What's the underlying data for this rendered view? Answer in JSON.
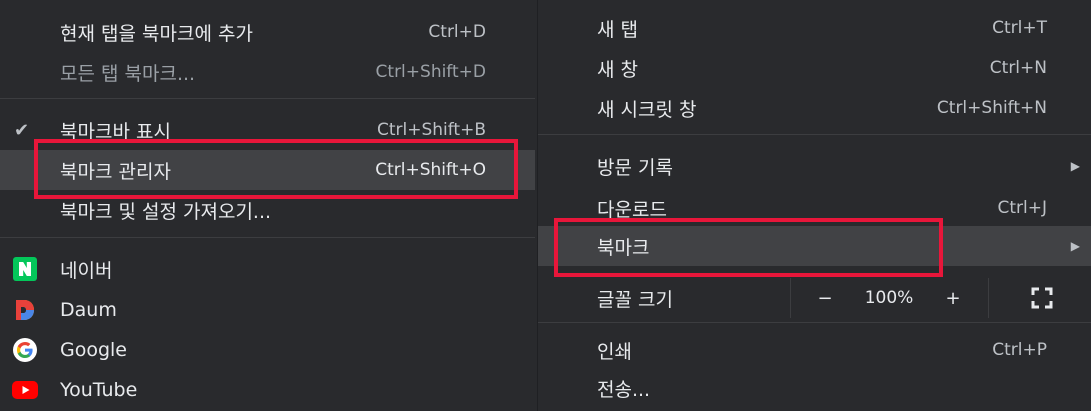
{
  "left_menu": {
    "items": [
      {
        "label": "현재 탭을 북마크에 추가",
        "shortcut": "Ctrl+D"
      },
      {
        "label": "모든 탭 북마크...",
        "shortcut": "Ctrl+Shift+D"
      },
      {
        "label": "북마크바 표시",
        "shortcut": "Ctrl+Shift+B",
        "checked": true
      },
      {
        "label": "북마크 관리자",
        "shortcut": "Ctrl+Shift+O"
      },
      {
        "label": "북마크 및 설정 가져오기..."
      }
    ],
    "bookmarks": [
      {
        "label": "네이버",
        "icon": "naver-icon"
      },
      {
        "label": "Daum",
        "icon": "daum-icon"
      },
      {
        "label": "Google",
        "icon": "google-icon"
      },
      {
        "label": "YouTube",
        "icon": "youtube-icon"
      }
    ]
  },
  "right_menu": {
    "items": [
      {
        "label": "새 탭",
        "shortcut": "Ctrl+T"
      },
      {
        "label": "새 창",
        "shortcut": "Ctrl+N"
      },
      {
        "label": "새 시크릿 창",
        "shortcut": "Ctrl+Shift+N"
      },
      {
        "label": "방문 기록"
      },
      {
        "label": "다운로드",
        "shortcut": "Ctrl+J"
      },
      {
        "label": "북마크"
      },
      {
        "label": "글꼴 크기"
      },
      {
        "label": "인쇄",
        "shortcut": "Ctrl+P"
      },
      {
        "label": "전송..."
      }
    ],
    "zoom": {
      "minus": "−",
      "value": "100%",
      "plus": "+"
    }
  },
  "colors": {
    "highlight_box": "#e8163a",
    "menu_bg": "#292a2d",
    "hover_bg": "#414245"
  }
}
